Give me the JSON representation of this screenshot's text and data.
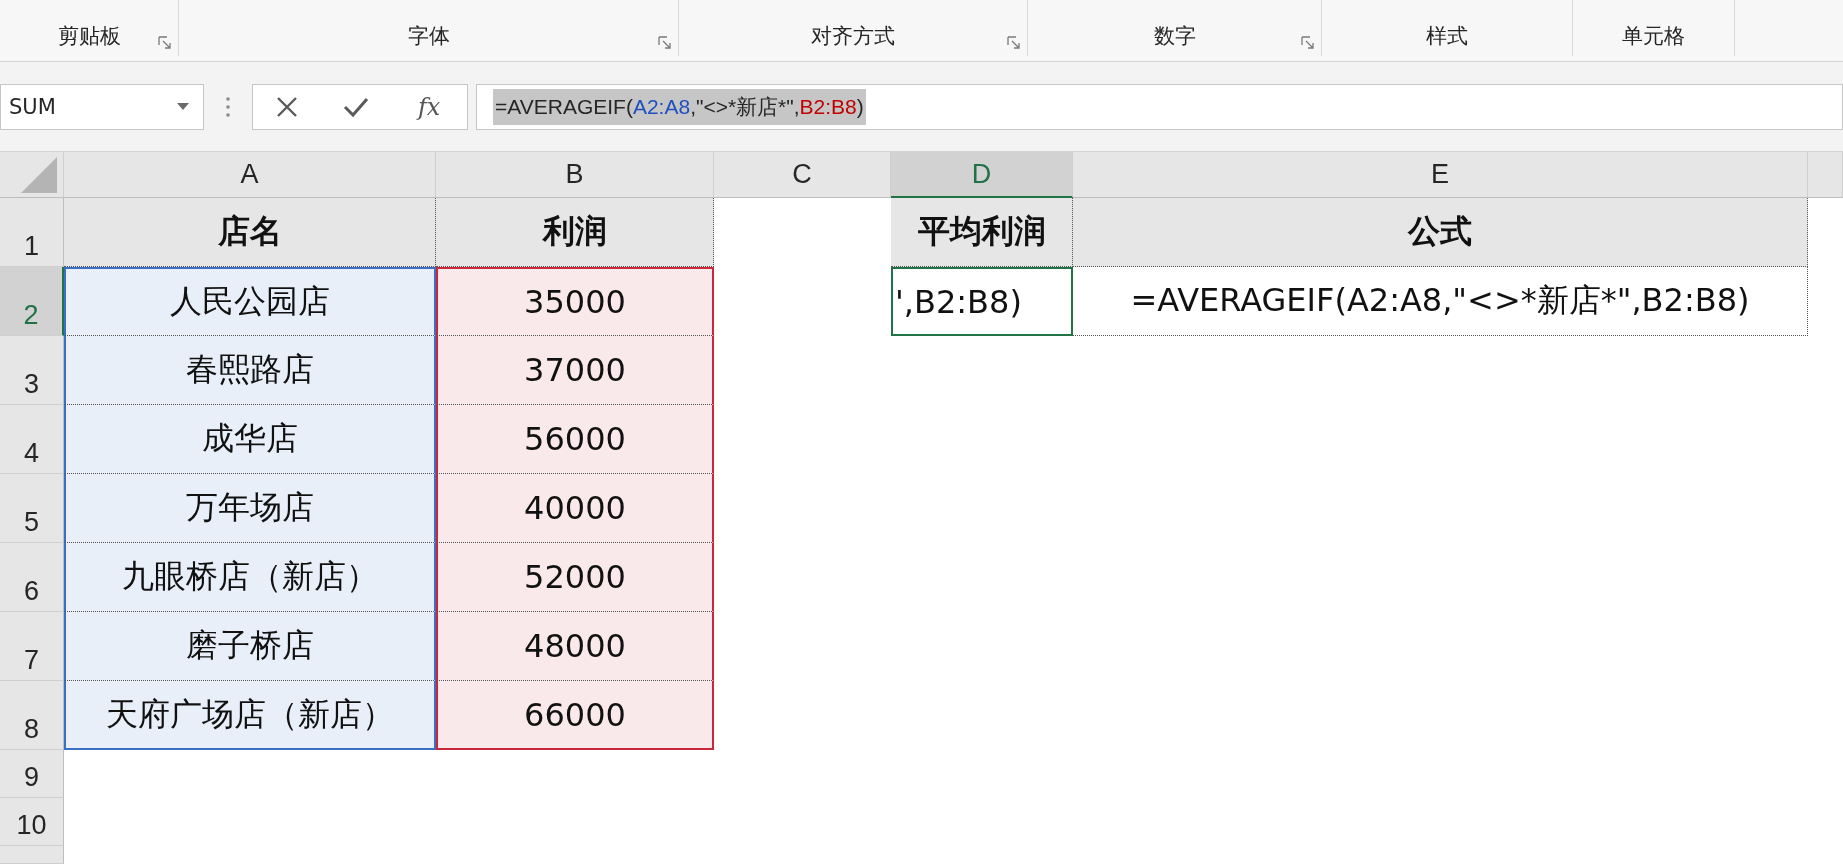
{
  "ribbon": {
    "groups": [
      {
        "label": "剪贴板",
        "launcher": true
      },
      {
        "label": "字体",
        "launcher": true
      },
      {
        "label": "对齐方式",
        "launcher": true
      },
      {
        "label": "数字",
        "launcher": true
      },
      {
        "label": "样式",
        "launcher": false
      },
      {
        "label": "单元格",
        "launcher": false
      }
    ]
  },
  "formula_bar": {
    "name_box": "SUM",
    "function_button": "fx",
    "text_selected": true,
    "parts": [
      {
        "text": "=AVERAGEIF(",
        "color": "#262626"
      },
      {
        "text": "A2:A8",
        "color": "#1f4fbf"
      },
      {
        "text": ",\"<>*新店*\",",
        "color": "#262626"
      },
      {
        "text": "B2:B8",
        "color": "#c00000"
      },
      {
        "text": ")",
        "color": "#262626"
      }
    ]
  },
  "columns": [
    {
      "label": "A",
      "selected": false
    },
    {
      "label": "B",
      "selected": false
    },
    {
      "label": "C",
      "selected": false
    },
    {
      "label": "D",
      "selected": true
    },
    {
      "label": "E",
      "selected": false
    }
  ],
  "rows": [
    {
      "header": "1",
      "selected": false,
      "cells": [
        {
          "kind": "title",
          "text": "店名",
          "selected": false
        },
        {
          "kind": "title",
          "text": "利润",
          "selected": false
        },
        {
          "kind": "blank",
          "selected": false
        },
        {
          "kind": "title",
          "text": "平均利润",
          "selected": false
        },
        {
          "kind": "title",
          "text": "公式",
          "selected": false
        }
      ]
    },
    {
      "header": "2",
      "selected": true,
      "cells": [
        {
          "kind": "ref1",
          "text": "人民公园店",
          "selected": false
        },
        {
          "kind": "ref2",
          "text": "35000",
          "selected": false
        },
        {
          "kind": "blank",
          "selected": false
        },
        {
          "kind": "edit",
          "text": "',B2:B8)",
          "selected": true
        },
        {
          "kind": "plain",
          "text": "=AVERAGEIF(A2:A8,\"<>*新店*\",B2:B8)",
          "selected": false
        }
      ]
    },
    {
      "header": "3",
      "selected": false,
      "cells": [
        {
          "kind": "ref1",
          "text": "春熙路店",
          "selected": false
        },
        {
          "kind": "ref2",
          "text": "37000",
          "selected": false
        }
      ]
    },
    {
      "header": "4",
      "selected": false,
      "cells": [
        {
          "kind": "ref1",
          "text": "成华店",
          "selected": false
        },
        {
          "kind": "ref2",
          "text": "56000",
          "selected": false
        }
      ]
    },
    {
      "header": "5",
      "selected": false,
      "cells": [
        {
          "kind": "ref1",
          "text": "万年场店",
          "selected": false
        },
        {
          "kind": "ref2",
          "text": "40000",
          "selected": false
        }
      ]
    },
    {
      "header": "6",
      "selected": false,
      "cells": [
        {
          "kind": "ref1",
          "text": "九眼桥店（新店）",
          "selected": false
        },
        {
          "kind": "ref2",
          "text": "52000",
          "selected": false
        }
      ]
    },
    {
      "header": "7",
      "selected": false,
      "cells": [
        {
          "kind": "ref1",
          "text": "磨子桥店",
          "selected": false
        },
        {
          "kind": "ref2",
          "text": "48000",
          "selected": false
        }
      ]
    },
    {
      "header": "8",
      "selected": false,
      "cells": [
        {
          "kind": "ref1",
          "text": "天府广场店（新店）",
          "selected": false
        },
        {
          "kind": "ref2",
          "text": "66000",
          "selected": false
        }
      ]
    },
    {
      "header": "9",
      "selected": false
    },
    {
      "header": "10",
      "selected": false
    }
  ]
}
